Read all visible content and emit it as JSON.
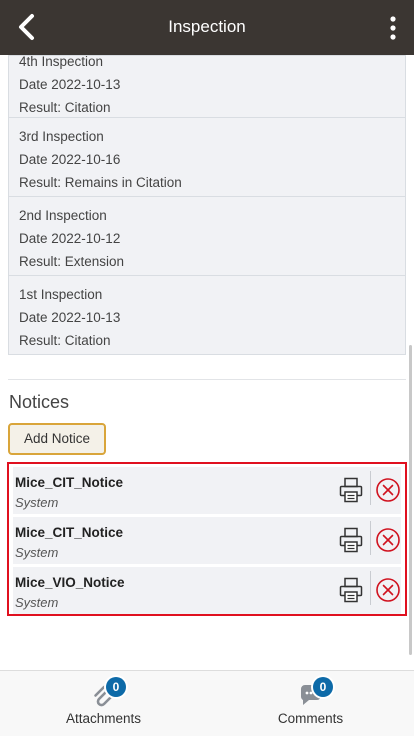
{
  "header": {
    "title": "Inspection",
    "back_icon": "back-arrow-icon",
    "menu_icon": "more-vertical-icon"
  },
  "inspections": [
    {
      "name": "4th Inspection",
      "date": "Date 2022-10-13",
      "result": "Result: Citation"
    },
    {
      "name": "3rd Inspection",
      "date": "Date 2022-10-16",
      "result": "Result: Remains in Citation"
    },
    {
      "name": "2nd Inspection",
      "date": "Date 2022-10-12",
      "result": "Result: Extension"
    },
    {
      "name": "1st Inspection",
      "date": "Date 2022-10-13",
      "result": "Result: Citation"
    }
  ],
  "notices": {
    "title": "Notices",
    "add_label": "Add Notice",
    "items": [
      {
        "name": "Mice_CIT_Notice",
        "source": "System"
      },
      {
        "name": "Mice_CIT_Notice",
        "source": "System"
      },
      {
        "name": "Mice_VIO_Notice",
        "source": "System"
      }
    ]
  },
  "footer": {
    "attachments": {
      "label": "Attachments",
      "count": "0",
      "icon": "paperclip-icon"
    },
    "comments": {
      "label": "Comments",
      "count": "0",
      "icon": "chat-bubble-icon"
    }
  },
  "colors": {
    "header_bg": "#3b3632",
    "accent_border": "#d9a53a",
    "highlight_border": "#e0101f",
    "delete_icon": "#d0121f",
    "badge": "#0d6aa8"
  }
}
